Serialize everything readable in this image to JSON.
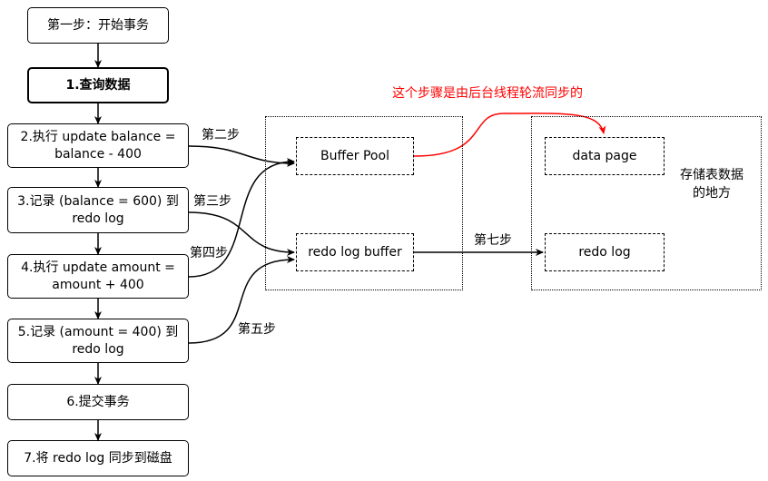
{
  "steps": {
    "s0": "第一步：开始事务",
    "s1": "1.查询数据",
    "s2": "2.执行 update balance =\nbalance - 400",
    "s3": "3.记录 (balance = 600) 到\nredo log",
    "s4": "4.执行 update amount =\namount + 400",
    "s5": "5.记录 (amount = 400) 到\nredo log",
    "s6": "6.提交事务",
    "s7": "7.将 redo log 同步到磁盘"
  },
  "memory": {
    "buffer_pool": "Buffer Pool",
    "redo_log_buffer": "redo log buffer"
  },
  "disk": {
    "data_page": "data page",
    "redo_log": "redo log",
    "note": "存储表数据\n的地方"
  },
  "edge_labels": {
    "step2": "第二步",
    "step3": "第三步",
    "step4": "第四步",
    "step5": "第五步",
    "step7": "第七步"
  },
  "sync_note": "这个步骤是由后台线程轮流同步的",
  "colors": {
    "sync_arrow": "#ff0000",
    "line": "#000000"
  }
}
